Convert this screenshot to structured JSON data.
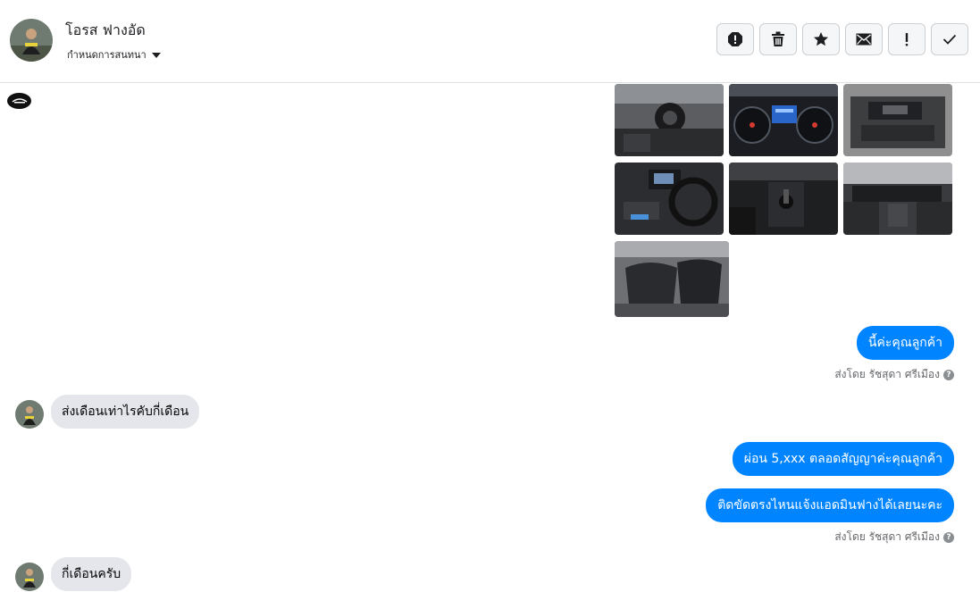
{
  "header": {
    "contact_name": "โอรส ฟางอัด",
    "assign_label": "กำหนดการสนทนา",
    "toolbar_icons": [
      "spam-icon",
      "trash-icon",
      "star-icon",
      "envelope-icon",
      "exclamation-icon",
      "check-icon"
    ]
  },
  "messages": [
    {
      "direction": "out",
      "kind": "photos",
      "photo_count": 7
    },
    {
      "direction": "out",
      "text": "นี้ค่ะคุณลูกค้า",
      "sent_by": "ส่งโดย รัชสุดา ศรีเมือง"
    },
    {
      "direction": "in",
      "text": "ส่งเดือนเท่าไรคับกี่เดือน"
    },
    {
      "direction": "out",
      "text": "ผ่อน 5,xxx ตลอดสัญญาค่ะคุณลูกค้า"
    },
    {
      "direction": "out",
      "text": "ติดขัดตรงไหนแจ้งแอดมินฟางได้เลยนะคะ",
      "sent_by": "ส่งโดย รัชสุดา ศรีเมือง"
    },
    {
      "direction": "in",
      "text": "กี่เดือนครับ"
    }
  ],
  "colors": {
    "outgoing_bubble": "#0084ff",
    "incoming_bubble": "#e4e6eb",
    "divider": "#dddfe2"
  }
}
